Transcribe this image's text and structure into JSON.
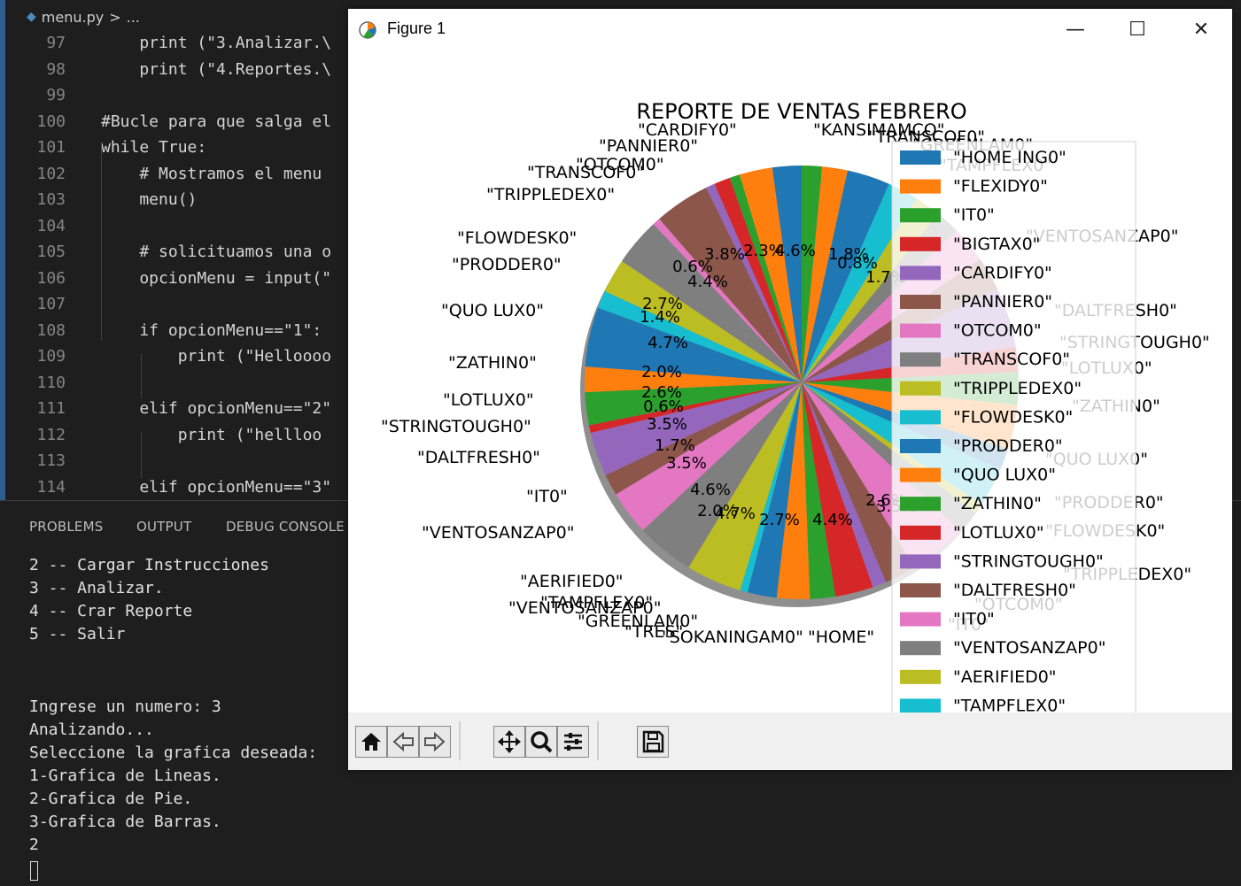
{
  "editor": {
    "breadcrumb": {
      "file": "menu.py",
      "sep": ">",
      "rest": "..."
    },
    "lines": [
      {
        "n": "97",
        "code": "    print (\"3.Analizar.\\"
      },
      {
        "n": "98",
        "code": "    print (\"4.Reportes.\\"
      },
      {
        "n": "99",
        "code": ""
      },
      {
        "n": "100",
        "code": "#Bucle para que salga el"
      },
      {
        "n": "101",
        "code": "while True:"
      },
      {
        "n": "102",
        "code": "    # Mostramos el menu"
      },
      {
        "n": "103",
        "code": "    menu()"
      },
      {
        "n": "104",
        "code": ""
      },
      {
        "n": "105",
        "code": "    # solicituamos una o"
      },
      {
        "n": "106",
        "code": "    opcionMenu = input(\""
      },
      {
        "n": "107",
        "code": ""
      },
      {
        "n": "108",
        "code": "    if opcionMenu==\"1\":"
      },
      {
        "n": "109",
        "code": "        print (\"Helloooo"
      },
      {
        "n": "110",
        "code": ""
      },
      {
        "n": "111",
        "code": "    elif opcionMenu==\"2\""
      },
      {
        "n": "112",
        "code": "        print (\"hellloo"
      },
      {
        "n": "113",
        "code": ""
      },
      {
        "n": "114",
        "code": "    elif opcionMenu==\"3\""
      }
    ]
  },
  "panel": {
    "tabs": [
      "PROBLEMS",
      "OUTPUT",
      "DEBUG CONSOLE"
    ],
    "terminal": [
      "2 -- Cargar Instrucciones",
      "3 -- Analizar.",
      "4 -- Crar Reporte",
      "5 -- Salir",
      "",
      "",
      "Ingrese un numero: 3",
      "Analizando...",
      "Seleccione la grafica deseada:",
      "1-Grafica de Lineas.",
      "2-Grafica de Pie.",
      "3-Grafica de Barras.",
      "2"
    ]
  },
  "figure": {
    "window_title": "Figure 1",
    "buttons": {
      "minimize": "—",
      "maximize": "☐",
      "close": "✕"
    },
    "toolbar": [
      "home-icon",
      "back-icon",
      "forward-icon",
      "pan-icon",
      "zoom-icon",
      "configure-icon",
      "save-icon"
    ]
  },
  "chart_data": {
    "type": "pie",
    "title": "REPORTE DE VENTAS FEBRERO",
    "legend_placement": "right",
    "colors": [
      "#1f77b4",
      "#ff7f0e",
      "#2ca02c",
      "#d62728",
      "#9467bd",
      "#8c564b",
      "#e377c2",
      "#7f7f7f",
      "#bcbd22",
      "#17becf"
    ],
    "legend": [
      "\"HOME ING0\"",
      "\"FLEXIDY0\"",
      "\"IT0\"",
      "\"BIGTAX0\"",
      "\"CARDIFY0\"",
      "\"PANNIER0\"",
      "\"OTCOM0\"",
      "\"TRANSCOF0\"",
      "\"TRIPPLEDEX0\"",
      "\"FLOWDESK0\"",
      "\"PRODDER0\"",
      "\"QUO LUX0\"",
      "\"ZATHIN0\"",
      "\"LOTLUX0\"",
      "\"STRINGTOUGH0\"",
      "\"DALTFRESH0\"",
      "\"IT0\"",
      "\"VENTOSANZAP0\"",
      "\"AERIFIED0\"",
      "\"TAMPFLEX0\""
    ],
    "outer_labels": [
      "\"PANNIER0\"",
      "\"TRANSCOF0\"",
      "\"TRIPPLEDEX0\"",
      "\"FLOWDESK0\"",
      "\"PRODDER0\"",
      "\"QUO LUX0\"",
      "\"ZATHIN0\"",
      "\"LOTLUX0\"",
      "\"STRINGTOUGH0\"",
      "\"DALTFRESH0\"",
      "\"IT0\"",
      "\"VENTOSANZAP0\"",
      "\"AERIFIED0\"",
      "\"VENTOSANZAP0\"",
      "\"GREENLAM0\"",
      "\"SOKANINGAM0\"",
      "\"HOME\"",
      "\"TAMPFLEX0\"",
      "\"TRES\"",
      "\"CARDIFY0\"",
      "\"OTCOM0\"",
      "\"KANSIMAMCO\"",
      "\"TRANSCOF0\"",
      "\"GREENLAM0\"",
      "\"TAMPFLEX0\"",
      "\"VENTOSANZAP0\"",
      "\"DALTFRESH0\"",
      "\"STRINGTOUGH0\"",
      "\"LOTLUX0\"",
      "\"ZATHIN0\"",
      "\"QUO LUX0\"",
      "\"PRODDER0\"",
      "\"FLOWDESK0\"",
      "\"TRIPPLEDEX0\"",
      "\"OTCOM0\"",
      "\"IT0\""
    ],
    "pct_labels": [
      "2.7%",
      "1.4%",
      "4.7%",
      "2.0%",
      "2.6%",
      "0.6%",
      "3.5%",
      "1.7%",
      "3.5%",
      "4.6%",
      "4.4%",
      "0.6%",
      "3.8%",
      "2.3%",
      "4.6%",
      "1.8%",
      "0.8%",
      "1.7%",
      "3.5%",
      "2.6%",
      "2.0%",
      "4.7%",
      "2.7%",
      "4.4%"
    ],
    "values": [
      2.3,
      2.6,
      0.8,
      1.3,
      0.7,
      4.4,
      0.6,
      3.8,
      2.7,
      1.4,
      4.7,
      2.0,
      2.6,
      0.6,
      3.5,
      1.7,
      3.5,
      4.6,
      4.4,
      0.6,
      2.3,
      2.6,
      2.0,
      3.0,
      1.1,
      2.5,
      4.6,
      1.8,
      0.8,
      3.1,
      1.7,
      3.5,
      2.6,
      2.0,
      4.7,
      2.7,
      2.9,
      1.9,
      2.1,
      2.4,
      3.4,
      2.0,
      1.6
    ]
  }
}
